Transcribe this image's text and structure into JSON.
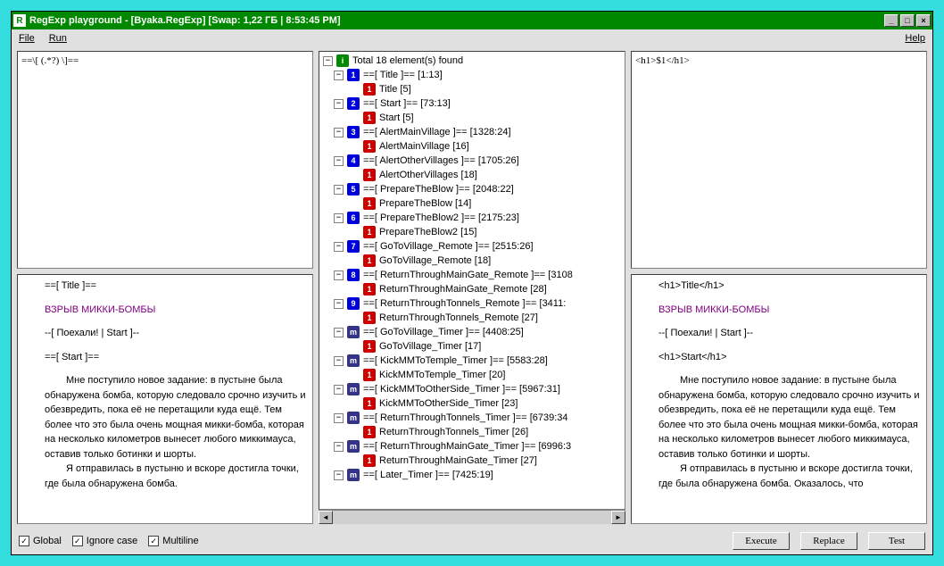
{
  "title": "RegExp playground - [Byaka.RegExp] [Swap: 1,22 ГБ | 8:53:45 PM]",
  "menu": {
    "file": "File",
    "run": "Run",
    "help": "Help"
  },
  "regex": "==\\[ (.*?) \\]==",
  "replace": "<h1>$1</h1>",
  "source": {
    "l1": "==[ Title ]==",
    "l2": "ВЗРЫВ МИККИ-БОМБЫ",
    "l3": "--[ Поехали! | Start ]--",
    "l4": "==[ Start ]==",
    "p1": "Мне поступило новое задание: в пустыне была обнаружена бомба, которую следовало срочно изучить и обезвредить, пока её не перетащили куда ещё. Тем более что это была очень мощная микки-бомба, которая на несколько километров вынесет любого миккимауса, оставив только ботинки и шорты.",
    "p2": "Я отправилась в пустыню и вскоре достигла точки, где была обнаружена бомба."
  },
  "result": {
    "l1": "<h1>Title</h1>",
    "l2": "ВЗРЫВ МИККИ-БОМБЫ",
    "l3": "--[ Поехали! | Start ]--",
    "l4": "<h1>Start</h1>",
    "p1": "Мне поступило новое задание: в пустыне была обнаружена бомба, которую следовало срочно изучить и обезвредить, пока её не перетащили куда ещё. Тем более что это была очень мощная микки-бомба, которая на несколько километров вынесет любого миккимауса, оставив только ботинки и шорты.",
    "p2": "Я отправилась в пустыню и вскоре достигла точки, где была обнаружена бомба. Оказалось, что"
  },
  "tree_root": "Total 18 element(s) found",
  "tree": [
    {
      "n": "1",
      "t": "==[ Title ]== [1:13]",
      "c": {
        "t": "Title [5]"
      }
    },
    {
      "n": "2",
      "t": "==[ Start ]== [73:13]",
      "c": {
        "t": "Start [5]"
      }
    },
    {
      "n": "3",
      "t": "==[ AlertMainVillage ]== [1328:24]",
      "c": {
        "t": "AlertMainVillage [16]"
      }
    },
    {
      "n": "4",
      "t": "==[ AlertOtherVillages ]== [1705:26]",
      "c": {
        "t": "AlertOtherVillages [18]"
      }
    },
    {
      "n": "5",
      "t": "==[ PrepareTheBlow ]== [2048:22]",
      "c": {
        "t": "PrepareTheBlow [14]"
      }
    },
    {
      "n": "6",
      "t": "==[ PrepareTheBlow2 ]== [2175:23]",
      "c": {
        "t": "PrepareTheBlow2 [15]"
      }
    },
    {
      "n": "7",
      "t": "==[ GoToVillage_Remote ]== [2515:26]",
      "c": {
        "t": "GoToVillage_Remote [18]"
      }
    },
    {
      "n": "8",
      "t": "==[ ReturnThroughMainGate_Remote ]== [3108",
      "c": {
        "t": "ReturnThroughMainGate_Remote [28]"
      }
    },
    {
      "n": "9",
      "t": "==[ ReturnThroughTonnels_Remote ]== [3411:",
      "c": {
        "t": "ReturnThroughTonnels_Remote [27]"
      }
    },
    {
      "n": "m",
      "t": "==[ GoToVillage_Timer ]== [4408:25]",
      "c": {
        "t": "GoToVillage_Timer [17]"
      }
    },
    {
      "n": "m",
      "t": "==[ KickMMToTemple_Timer ]== [5583:28]",
      "c": {
        "t": "KickMMToTemple_Timer [20]"
      }
    },
    {
      "n": "m",
      "t": "==[ KickMMToOtherSide_Timer ]== [5967:31]",
      "c": {
        "t": "KickMMToOtherSide_Timer [23]"
      }
    },
    {
      "n": "m",
      "t": "==[ ReturnThroughTonnels_Timer ]== [6739:34",
      "c": {
        "t": "ReturnThroughTonnels_Timer [26]"
      }
    },
    {
      "n": "m",
      "t": "==[ ReturnThroughMainGate_Timer ]== [6996:3",
      "c": {
        "t": "ReturnThroughMainGate_Timer [27]"
      }
    },
    {
      "n": "m",
      "t": "==[ Later_Timer ]== [7425:19]",
      "c": {
        "t": ""
      }
    }
  ],
  "checks": {
    "global": "Global",
    "icase": "Ignore case",
    "multi": "Multiline"
  },
  "buttons": {
    "exec": "Execute",
    "repl": "Replace",
    "test": "Test"
  }
}
